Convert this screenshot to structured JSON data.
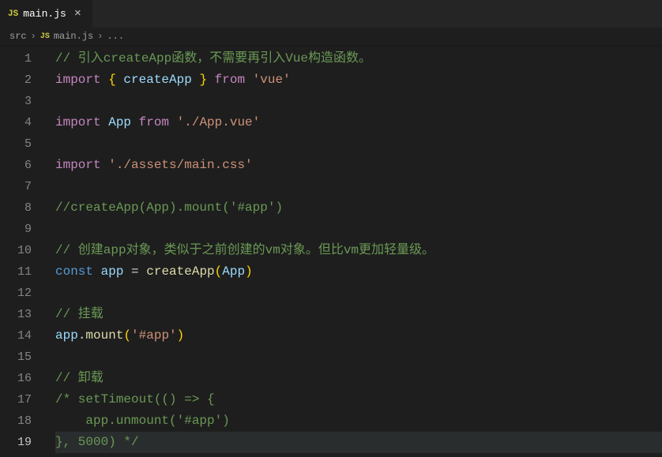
{
  "tab": {
    "icon_label": "JS",
    "filename": "main.js"
  },
  "breadcrumbs": {
    "part1": "src",
    "sep": "›",
    "icon": "JS",
    "part2": "main.js",
    "ellipsis": "..."
  },
  "lines": {
    "l1": "1",
    "l2": "2",
    "l3": "3",
    "l4": "4",
    "l5": "5",
    "l6": "6",
    "l7": "7",
    "l8": "8",
    "l9": "9",
    "l10": "10",
    "l11": "11",
    "l12": "12",
    "l13": "13",
    "l14": "14",
    "l15": "15",
    "l16": "16",
    "l17": "17",
    "l18": "18",
    "l19": "19"
  },
  "code": {
    "l1_comment": "// 引入createApp函数，不需要再引入Vue构造函数。",
    "l2_import": "import",
    "l2_brace_o": " { ",
    "l2_ident": "createApp",
    "l2_brace_c": " } ",
    "l2_from": "from",
    "l2_str": " 'vue'",
    "l4_import": "import",
    "l4_app": " App ",
    "l4_from": "from",
    "l4_str": " './App.vue'",
    "l6_import": "import",
    "l6_str": " './assets/main.css'",
    "l8_comment": "//createApp(App).mount('#app')",
    "l10_comment": "// 创建app对象，类似于之前创建的vm对象。但比vm更加轻量级。",
    "l11_const": "const",
    "l11_app": " app ",
    "l11_eq": "= ",
    "l11_fn": "createApp",
    "l11_po": "(",
    "l11_arg": "App",
    "l11_pc": ")",
    "l13_comment": "// 挂载",
    "l14_obj": "app",
    "l14_dot": ".",
    "l14_fn": "mount",
    "l14_po": "(",
    "l14_str": "'#app'",
    "l14_pc": ")",
    "l16_comment": "// 卸载",
    "l17_comment": "/* setTimeout(() => {",
    "l18_comment": "    app.unmount('#app')",
    "l19_comment": "}, 5000) */"
  }
}
